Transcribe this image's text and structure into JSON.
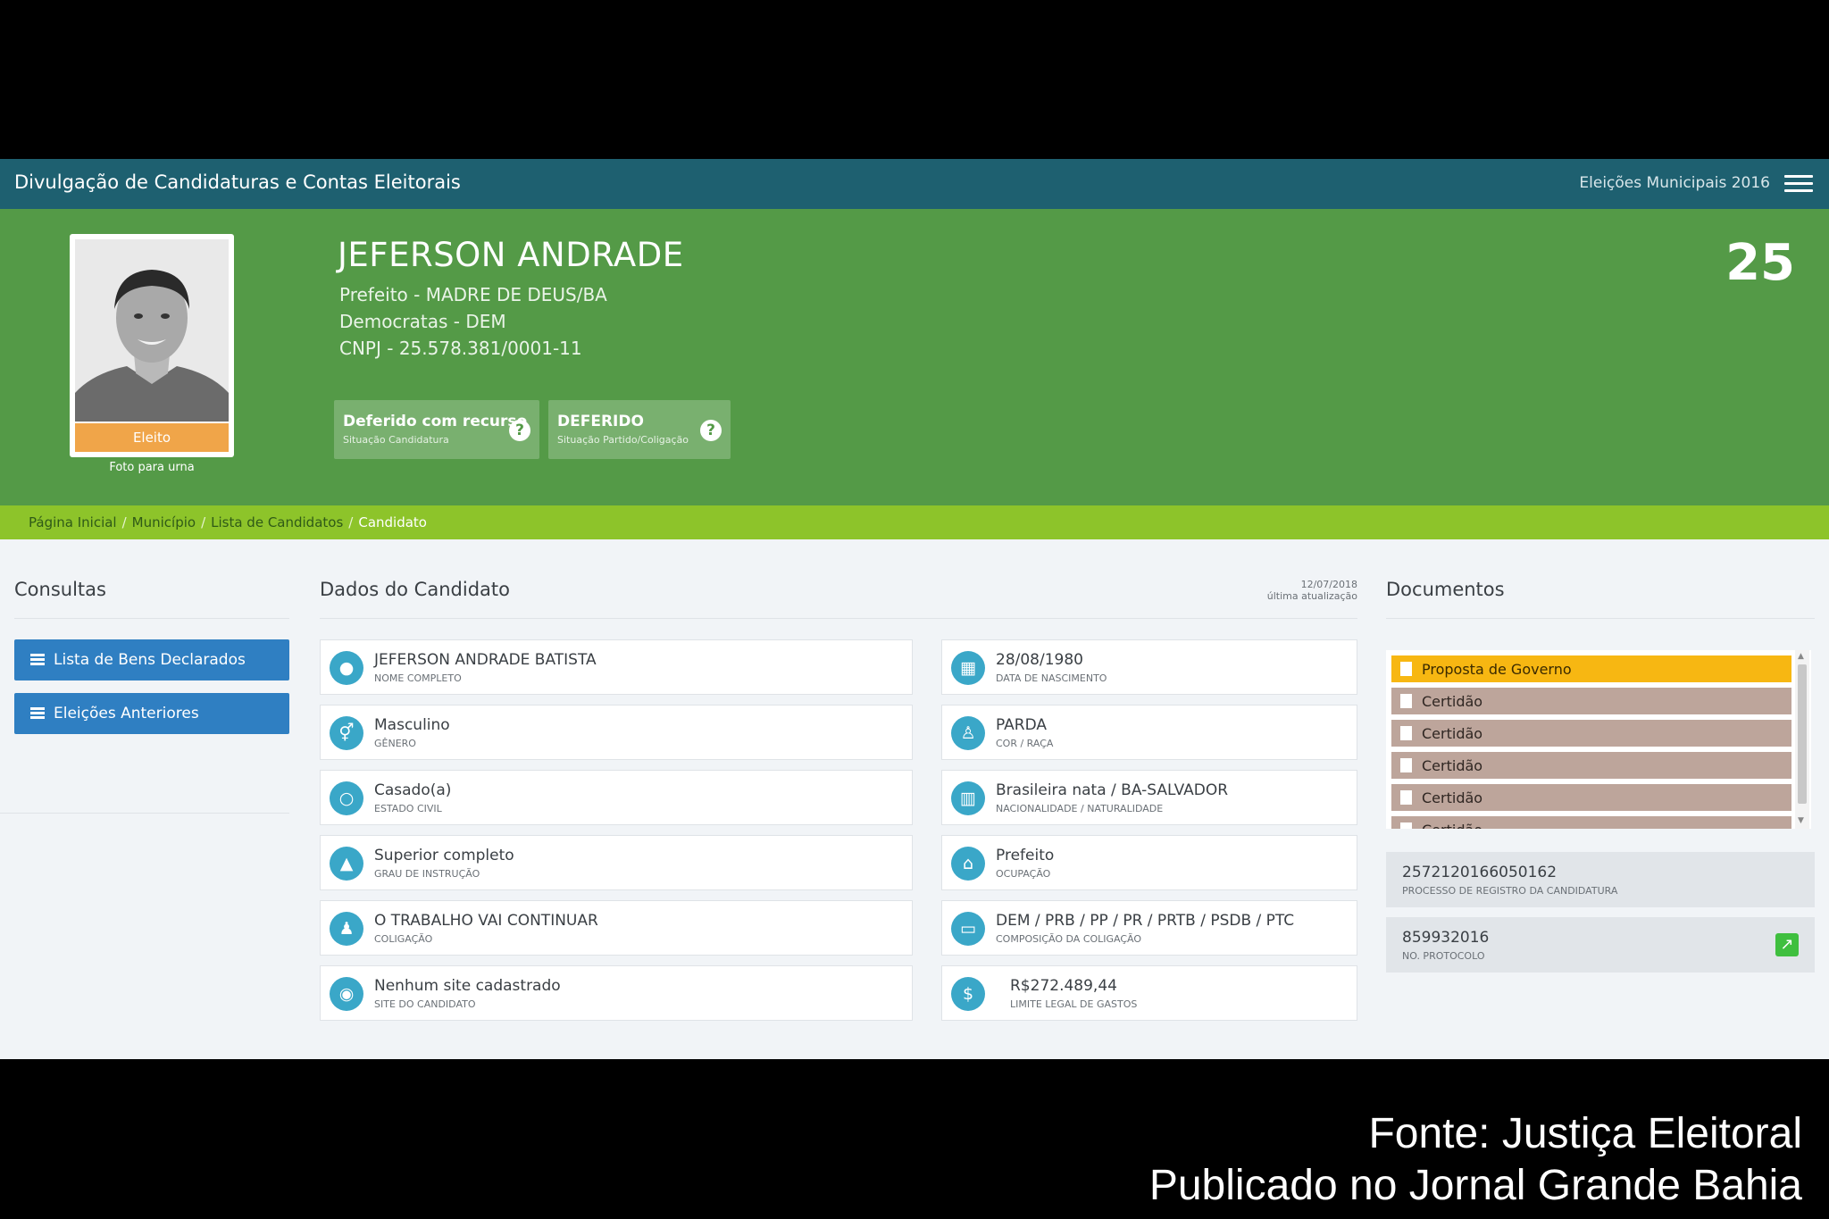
{
  "topbar": {
    "title": "Divulgação de Candidaturas e Contas Eleitorais",
    "election": "Eleições Municipais 2016"
  },
  "candidate": {
    "name": "JEFERSON ANDRADE",
    "office": "Prefeito - MADRE DE DEUS/BA",
    "party": "Democratas - DEM",
    "cnpj": "CNPJ - 25.578.381/0001-11",
    "number": "25",
    "tag": "Eleito",
    "photo_caption": "Foto para urna"
  },
  "status": [
    {
      "main": "Deferido com recurso",
      "sub": "Situação Candidatura"
    },
    {
      "main": "DEFERIDO",
      "sub": "Situação Partido/Coligação"
    }
  ],
  "breadcrumb": [
    "Página Inicial",
    "Município",
    "Lista de Candidatos",
    "Candidato"
  ],
  "sections": {
    "consultas": "Consultas",
    "dados": "Dados do Candidato",
    "documentos": "Documentos"
  },
  "update": {
    "date": "12/07/2018",
    "label": "última atualização"
  },
  "consultas": [
    "Lista de Bens Declarados",
    "Eleições Anteriores"
  ],
  "dados_left": [
    {
      "value": "JEFERSON ANDRADE BATISTA",
      "label": "Nome completo",
      "icon": "user-icon"
    },
    {
      "value": "Masculino",
      "label": "Gênero",
      "icon": "gender-icon"
    },
    {
      "value": "Casado(a)",
      "label": "Estado civil",
      "icon": "ring-icon"
    },
    {
      "value": "Superior completo",
      "label": "Grau de instrução",
      "icon": "graduation-cap-icon"
    },
    {
      "value": "O TRABALHO VAI CONTINUAR",
      "label": "Coligação",
      "icon": "group-icon"
    },
    {
      "value": "Nenhum site cadastrado",
      "label": "Site do candidato",
      "icon": "globe-icon"
    }
  ],
  "dados_right": [
    {
      "value": "28/08/1980",
      "label": "Data de nascimento",
      "icon": "calendar-icon"
    },
    {
      "value": "PARDA",
      "label": "Cor / raça",
      "icon": "person-icon"
    },
    {
      "value": "Brasileira nata / BA-SALVADOR",
      "label": "Nacionalidade / naturalidade",
      "icon": "map-icon"
    },
    {
      "value": "Prefeito",
      "label": "Ocupação",
      "icon": "bank-icon"
    },
    {
      "value": "DEM / PRB / PP / PR / PRTB / PSDB / PTC",
      "label": "Composição da coligação",
      "icon": "folder-icon"
    },
    {
      "value": "R$272.489,44",
      "label": "Limite legal de gastos",
      "icon": "dollar-icon"
    }
  ],
  "documentos": [
    "Proposta de Governo",
    "Certidão",
    "Certidão",
    "Certidão",
    "Certidão",
    "Certidão"
  ],
  "process": {
    "value": "2572120166050162",
    "label": "PROCESSO DE REGISTRO DA CANDIDATURA"
  },
  "protocol": {
    "value": "859932016",
    "label": "NO. PROTOCOLO"
  },
  "colors": {
    "topbar": "#1e6070",
    "hero": "#549a47",
    "breadcrumb": "#8dc42a",
    "button": "#2f7fc2",
    "highlight": "#f7b712",
    "doc": "#bda59b"
  },
  "credit": [
    "Fonte: Justiça Eleitoral",
    "Publicado no Jornal Grande Bahia"
  ]
}
